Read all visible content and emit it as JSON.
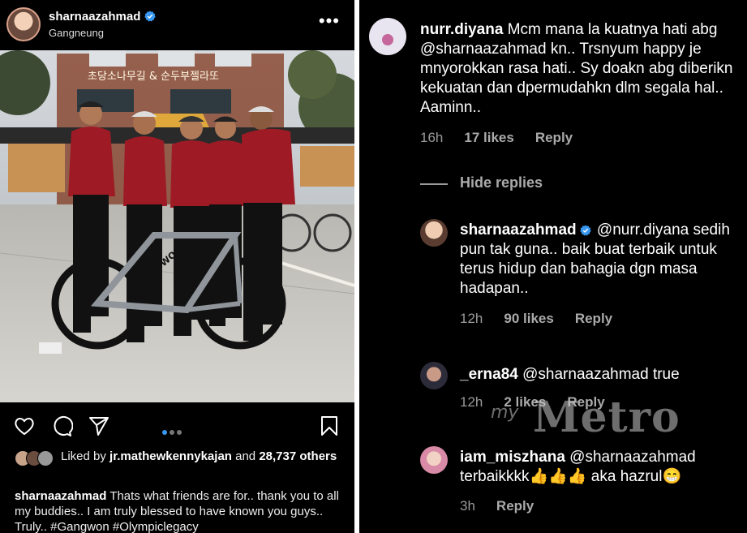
{
  "post": {
    "username": "sharnaazahmad",
    "location": "Gangneung",
    "photo_sign": "초당소나무길 & 순두부젤라또",
    "photo_bike_brand": "S-WORKS",
    "liked_prefix": "Liked by ",
    "liked_user": "jr.mathewkennykajan",
    "liked_and": " and ",
    "liked_count": "28,737",
    "liked_suffix": " others",
    "caption_user": "sharnaazahmad",
    "caption_text": " Thats what friends are for.. thank you to all my buddies.. I am truly blessed to have known you guys.. Truly.. #Gangwon #Olympiclegacy",
    "carousel_active": 1,
    "carousel_total": 3
  },
  "comments": {
    "hide_replies": "Hide replies",
    "items": [
      {
        "user": "nurr.diyana",
        "text": " Mcm mana la kuatnya hati abg @sharnaazahmad  kn.. Trsnyum happy je mnyorokkan rasa hati.. Sy doakn abg diberikn kekuatan dan dpermudahkn dlm segala hal.. Aaminn..",
        "time": "16h",
        "likes": "17 likes",
        "reply": "Reply"
      },
      {
        "user": "sharnaazahmad",
        "text": " @nurr.diyana sedih pun tak guna.. baik buat terbaik untuk terus hidup dan bahagia dgn masa hadapan..",
        "time": "12h",
        "likes": "90 likes",
        "reply": "Reply"
      },
      {
        "user": "_erna84",
        "text": " @sharnaazahmad true",
        "time": "12h",
        "likes": "2 likes",
        "reply": "Reply"
      },
      {
        "user": "iam_miszhana",
        "text": " @sharnaazahmad terbaikkkk👍👍👍 aka hazrul😁",
        "time": "3h",
        "likes": "",
        "reply": "Reply"
      }
    ]
  },
  "watermark": {
    "prefix": "my",
    "name": "Metro"
  },
  "colors": {
    "verified": "#3897f0",
    "carousel_active": "#3897f0",
    "jersey": "#9e1b25"
  }
}
